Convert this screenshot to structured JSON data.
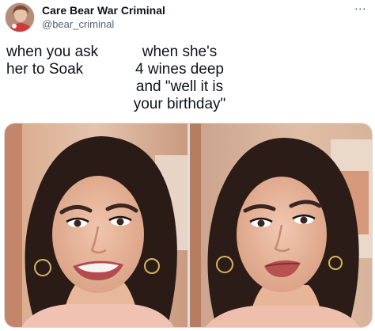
{
  "tweet": {
    "display_name": "Care Bear War Criminal",
    "handle": "@bear_criminal",
    "more_icon": "⋯",
    "caption_left": "when you ask\nher to Soak",
    "caption_right": "when she's\n4 wines deep\nand \"well it is\nyour birthday\""
  },
  "colors": {
    "text": "#0f1419",
    "secondary": "#536471",
    "border": "#d8d8d8"
  },
  "media": [
    {
      "name": "reaction-photo-left",
      "expression": "grimace"
    },
    {
      "name": "reaction-photo-right",
      "expression": "pursed-lips"
    }
  ]
}
